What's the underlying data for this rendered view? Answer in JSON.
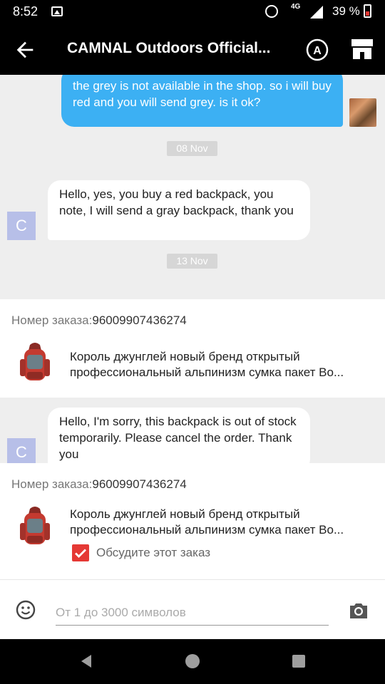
{
  "status_bar": {
    "time": "8:52",
    "network": "4G",
    "battery": "39 %"
  },
  "header": {
    "title": "CAMNAL Outdoors Official...",
    "back_icon": "arrow-left-icon",
    "translate_icon": "translate-icon",
    "store_icon": "store-icon"
  },
  "messages": [
    {
      "direction": "out",
      "text": "the grey is not available in the shop. so i will buy red and you will send grey. is it ok?"
    },
    {
      "type": "date",
      "text": "08 Nov"
    },
    {
      "direction": "in",
      "avatar": "C",
      "text": "Hello, yes, you buy a red backpack, you note, I will send a gray backpack, thank you"
    },
    {
      "type": "date",
      "text": "13 Nov"
    },
    {
      "direction": "in",
      "avatar": "C",
      "text": "Hello, I'm sorry, this backpack is out of stock temporarily. Please cancel the order. Thank you"
    }
  ],
  "order_card_1": {
    "label": "Номер заказа:",
    "number": "96009907436274",
    "product_line1": "Король джунглей новый бренд открытый",
    "product_line2": "профессиональный альпинизм сумка пакет Во..."
  },
  "order_card_2": {
    "label": "Номер заказа:",
    "number": "96009907436274",
    "product_line1": "Король джунглей новый бренд открытый",
    "product_line2": "профессиональный альпинизм сумка пакет Во...",
    "discuss_label": "Обсудите этот заказ",
    "discuss_checked": true
  },
  "input": {
    "placeholder": "От 1 до 3000 символов",
    "emoji_icon": "emoji-icon",
    "camera_icon": "camera-icon"
  },
  "colors": {
    "outgoing_bubble": "#3cb0f3",
    "checkbox": "#e53935",
    "avatar": "#b7bfe8"
  }
}
